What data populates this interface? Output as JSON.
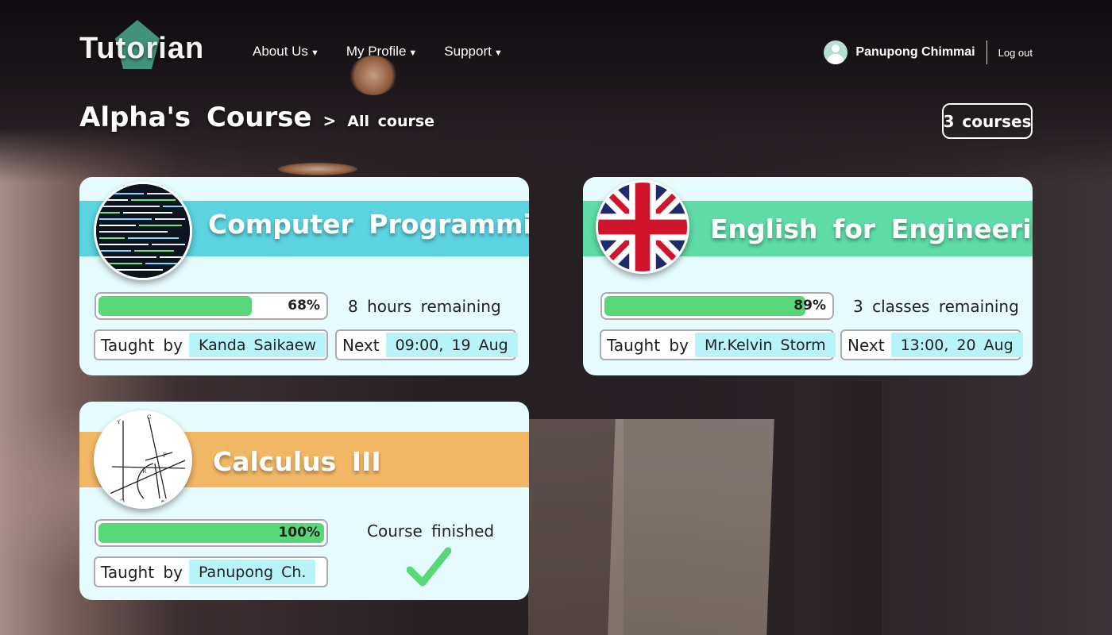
{
  "brand": {
    "logo_text": "Tutorian"
  },
  "nav": {
    "items": [
      {
        "label": "About Us"
      },
      {
        "label": "My Profile"
      },
      {
        "label": "Support"
      }
    ],
    "caret_icon": "caret-down-icon"
  },
  "user": {
    "name": "Panupong Chimmai",
    "logout_label": "Log out",
    "avatar_icon": "user-avatar-icon"
  },
  "breadcrumb": {
    "title": "Alpha's Course",
    "separator": ">",
    "current": "All course"
  },
  "course_count": "3 courses",
  "colors": {
    "band_blue": "#5bd3e0",
    "band_green": "#5edba6",
    "band_orange": "#f2b765",
    "progress_green": "#57d778",
    "card_bg": "#e6fbfd",
    "chip_highlight": "#b8f3fa"
  },
  "courses": [
    {
      "title": "Computer Programming",
      "thumbnail": "code-screen-image",
      "progress_fraction": 0.68,
      "progress_label": "68%",
      "remaining": "8 hours remaining",
      "taught_by_label": "Taught by",
      "teacher": "Kanda Saikaew",
      "next_label": "Next",
      "next_time": "09:00, 19 Aug"
    },
    {
      "title": "English for Engineering",
      "thumbnail": "uk-flag-image",
      "progress_fraction": 0.89,
      "progress_label": "89%",
      "remaining": "3 classes remaining",
      "taught_by_label": "Taught by",
      "teacher": "Mr.Kelvin Storm",
      "next_label": "Next",
      "next_time": "13:00, 20 Aug"
    },
    {
      "title": "Calculus III",
      "thumbnail": "geometry-diagram-image",
      "progress_fraction": 1.0,
      "progress_label": "100%",
      "status": "Course finished",
      "status_icon": "checkmark-icon",
      "taught_by_label": "Taught by",
      "teacher": "Panupong Ch."
    }
  ]
}
